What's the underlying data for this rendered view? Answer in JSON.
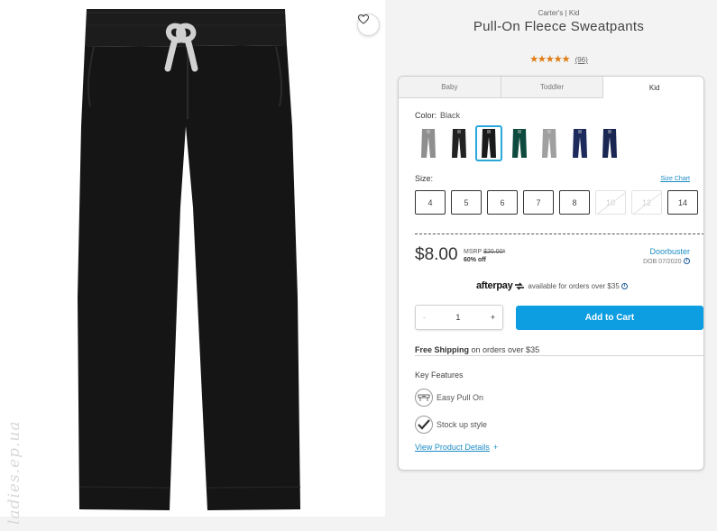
{
  "product": {
    "brand": "Carter's | Kid",
    "title": "Pull-On Fleece Sweatpants",
    "rating_stars": "★★★★★",
    "review_count": "(96)"
  },
  "tabs": [
    {
      "label": "Baby",
      "active": false
    },
    {
      "label": "Toddler",
      "active": false
    },
    {
      "label": "Kid",
      "active": true
    }
  ],
  "color": {
    "label": "Color:",
    "selected": "Black",
    "swatches": [
      {
        "color": "#8f8f8f",
        "selected": false
      },
      {
        "color": "#222222",
        "selected": false
      },
      {
        "color": "#1a1a1a",
        "selected": true
      },
      {
        "color": "#0e4a3e",
        "selected": false
      },
      {
        "color": "#a0a0a0",
        "selected": false
      },
      {
        "color": "#1d2a5c",
        "selected": false
      },
      {
        "color": "#1a2752",
        "selected": false
      }
    ]
  },
  "size": {
    "label": "Size:",
    "chart_link": "Size Chart",
    "options": [
      {
        "label": "4",
        "available": true
      },
      {
        "label": "5",
        "available": true
      },
      {
        "label": "6",
        "available": true
      },
      {
        "label": "7",
        "available": true
      },
      {
        "label": "8",
        "available": true
      },
      {
        "label": "10",
        "available": false
      },
      {
        "label": "12",
        "available": false
      },
      {
        "label": "14",
        "available": true
      }
    ]
  },
  "pricing": {
    "price": "$8.00",
    "msrp_label": "MSRP",
    "msrp_value": "$20.00*",
    "discount": "60% off",
    "promo": "Doorbuster",
    "promo_date": "DOB 07/2020"
  },
  "afterpay": {
    "logo": "afterpay",
    "text": "available for orders over $35"
  },
  "quantity": {
    "minus": "-",
    "value": "1",
    "plus": "+"
  },
  "cart": {
    "add_label": "Add to Cart"
  },
  "shipping": {
    "bold": "Free Shipping",
    "text": "on orders over $35"
  },
  "features": {
    "title": "Key Features",
    "items": [
      {
        "label": "Easy Pull On",
        "icon": "waistband-icon"
      },
      {
        "label": "Stock up style",
        "icon": "checkmark-icon"
      }
    ],
    "details_link": "View Product Details",
    "details_plus": "+"
  },
  "watermark": "ladies.ep.ua",
  "colors": {
    "accent": "#0d9ee2",
    "link": "#1b8cc4",
    "stars": "#e07b10",
    "selected_border": "#2aa7d9"
  }
}
